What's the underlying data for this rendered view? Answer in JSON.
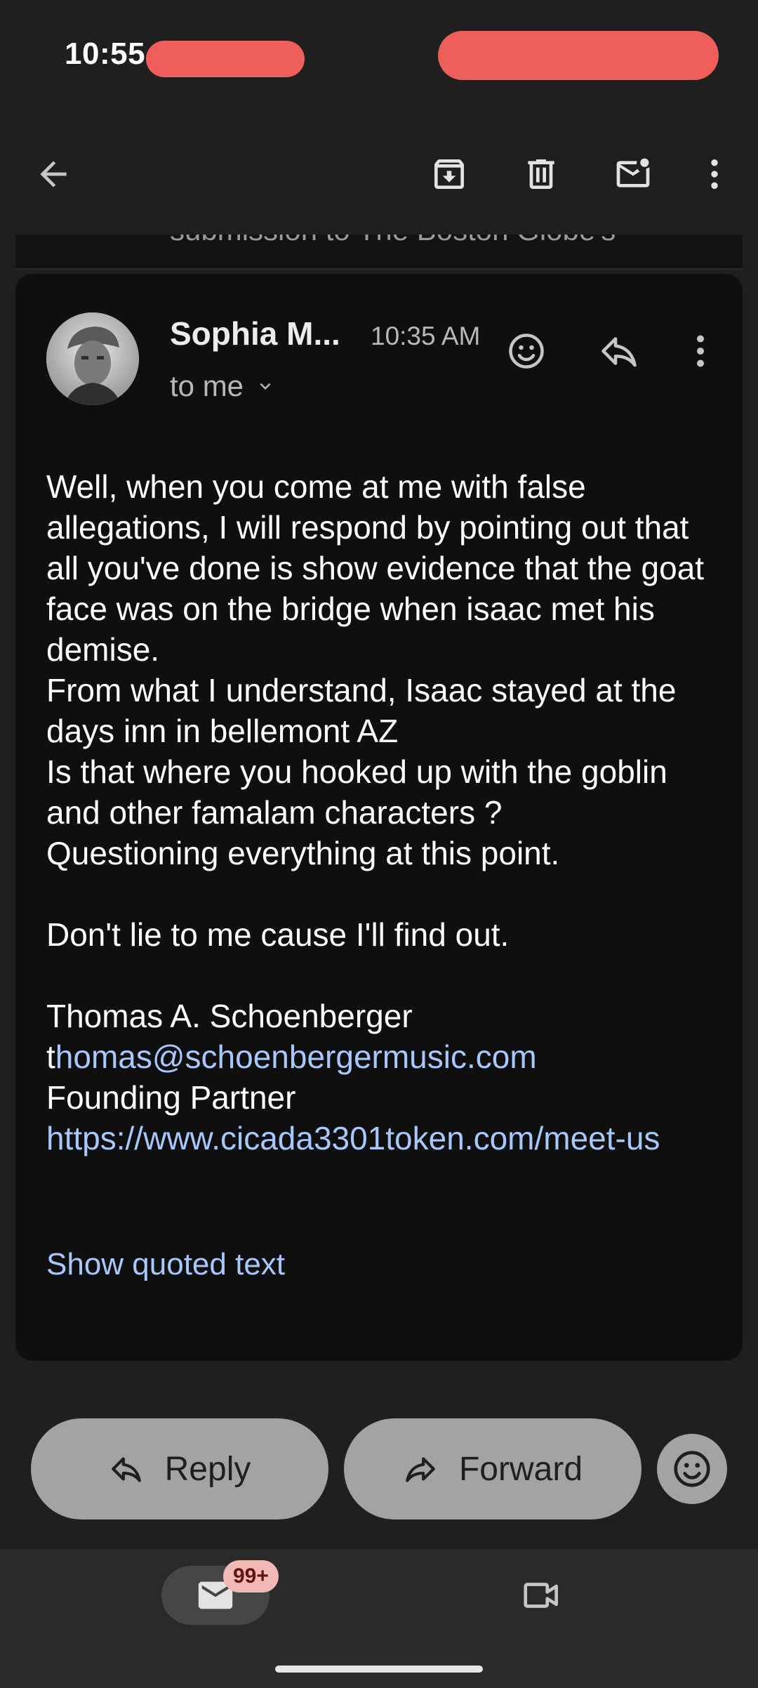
{
  "status_bar": {
    "time": "10:55"
  },
  "toolbar": {
    "back_icon": "arrow-left-icon",
    "archive_icon": "archive-icon",
    "delete_icon": "trash-icon",
    "mark_unread_icon": "mail-unread-icon",
    "more_icon": "more-vert-icon"
  },
  "previous_message": {
    "snippet": "submission to The Boston Globe's"
  },
  "message": {
    "sender": "Sophia M...",
    "time": "10:35 AM",
    "recipient": "to me",
    "body_paragraphs": [
      "Well, when you come at me with false allegations, I will respond by pointing out that all you've done is show evidence that the goat face was on the bridge when isaac met his demise.",
      "From what I understand, Isaac stayed at the days inn in bellemont AZ",
      "Is that where you hooked up with the goblin and other famalam characters ?",
      "Questioning everything at this point."
    ],
    "closing": "Don't lie to me cause I'll find out.",
    "signature": {
      "name": "Thomas A. Schoenberger",
      "email_prefix": "t",
      "email_link": "homas@schoenbergermusic.com",
      "title": "Founding Partner",
      "url": "https://www.cicada3301token.com/meet-us"
    },
    "show_quoted": "Show quoted text"
  },
  "actions": {
    "reply": "Reply",
    "forward": "Forward"
  },
  "bottom_nav": {
    "mail_badge": "99+"
  },
  "colors": {
    "link": "#a8c7fa",
    "badge": "#f2b8b5",
    "pill": "#a3a3a3"
  }
}
